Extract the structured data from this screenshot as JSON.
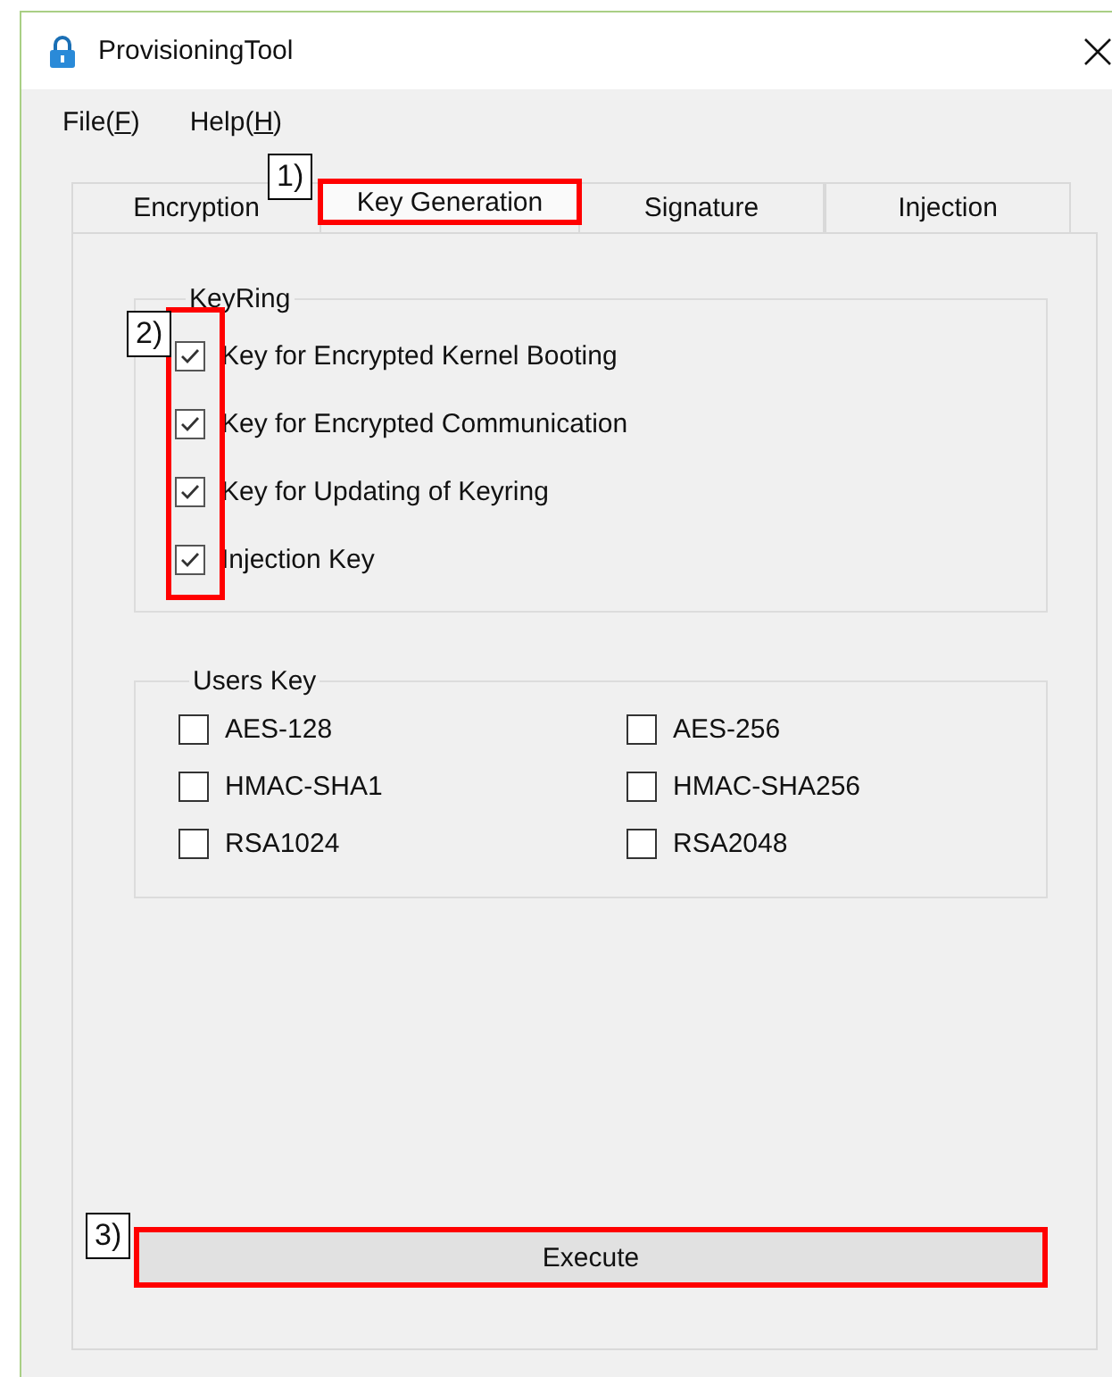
{
  "window": {
    "title": "ProvisioningTool"
  },
  "menu": [
    {
      "before": "File(",
      "key": "F",
      "after": ")"
    },
    {
      "before": "Help(",
      "key": "H",
      "after": ")"
    }
  ],
  "tabs": [
    {
      "label": "Encryption",
      "selected": false
    },
    {
      "label": "Key Generation",
      "selected": true,
      "callout": "1)"
    },
    {
      "label": "Signature",
      "selected": false
    },
    {
      "label": "Injection",
      "selected": false
    }
  ],
  "keyring": {
    "title": "KeyRing",
    "callout": "2)",
    "items": [
      {
        "label": "Key for Encrypted Kernel Booting",
        "checked": true
      },
      {
        "label": "Key for Encrypted Communication",
        "checked": true
      },
      {
        "label": "Key for Updating of Keyring",
        "checked": true
      },
      {
        "label": "Injection Key",
        "checked": true
      }
    ]
  },
  "users_key": {
    "title": "Users Key",
    "items": [
      {
        "label": "AES-128",
        "checked": false
      },
      {
        "label": "AES-256",
        "checked": false
      },
      {
        "label": "HMAC-SHA1",
        "checked": false
      },
      {
        "label": "HMAC-SHA256",
        "checked": false
      },
      {
        "label": "RSA1024",
        "checked": false
      },
      {
        "label": "RSA2048",
        "checked": false
      }
    ]
  },
  "execute": {
    "label": "Execute",
    "callout": "3)"
  }
}
